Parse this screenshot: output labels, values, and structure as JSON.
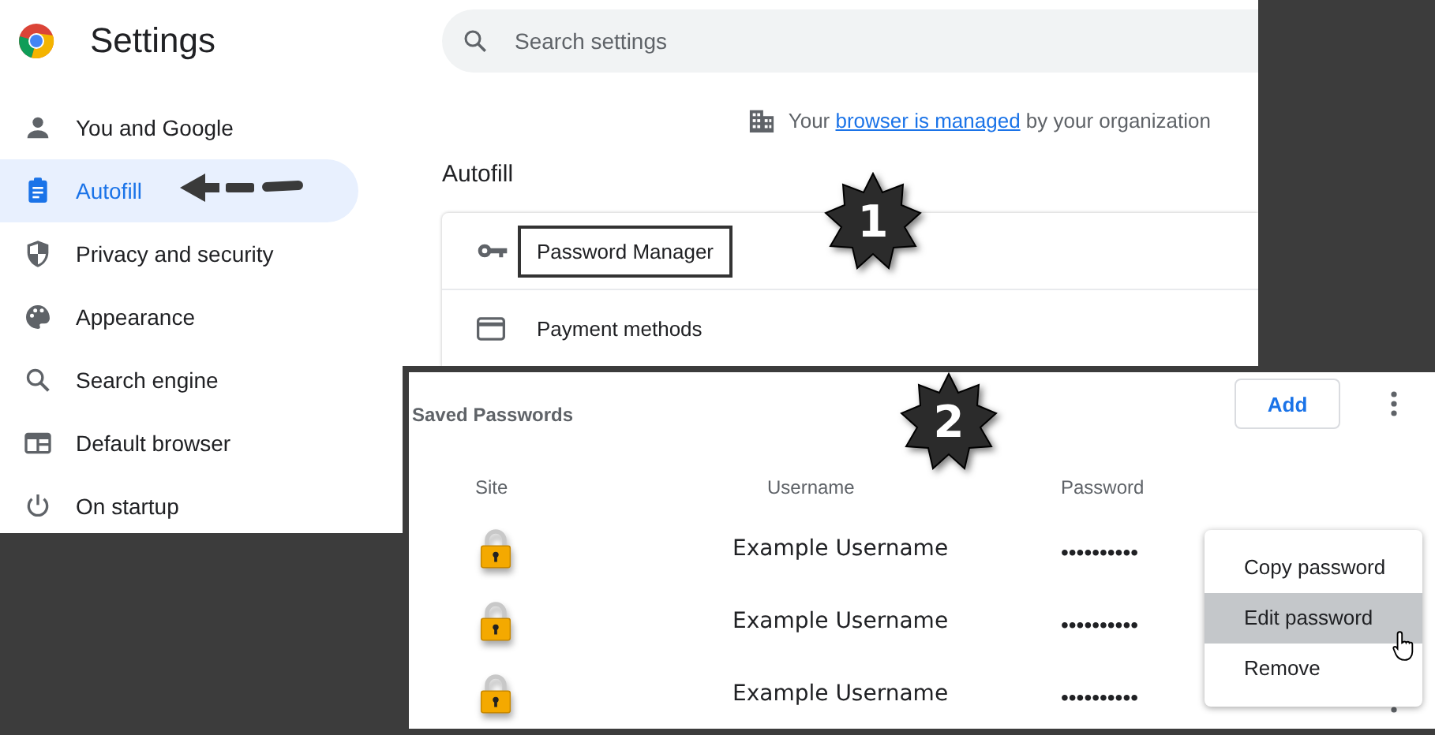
{
  "header": {
    "title": "Settings"
  },
  "search": {
    "placeholder": "Search settings"
  },
  "sidebar": {
    "items": [
      {
        "label": "You and Google",
        "selected": false
      },
      {
        "label": "Autofill",
        "selected": true
      },
      {
        "label": "Privacy and security",
        "selected": false
      },
      {
        "label": "Appearance",
        "selected": false
      },
      {
        "label": "Search engine",
        "selected": false
      },
      {
        "label": "Default browser",
        "selected": false
      },
      {
        "label": "On startup",
        "selected": false
      }
    ]
  },
  "managed_notice": {
    "before": "Your",
    "link": "browser is managed",
    "after": "by your organization"
  },
  "section_title": "Autofill",
  "autofill_items": [
    {
      "label": "Password Manager",
      "highlighted": true
    },
    {
      "label": "Payment methods",
      "highlighted": false
    }
  ],
  "callouts": [
    "1",
    "2"
  ],
  "saved_passwords": {
    "title": "Saved Passwords",
    "add_button": "Add",
    "columns": [
      "Site",
      "Username",
      "Password"
    ],
    "rows": [
      {
        "username": "Example Username",
        "password": "••••••••••"
      },
      {
        "username": "Example Username",
        "password": "••••••••••"
      },
      {
        "username": "Example Username",
        "password": "••••••••••"
      }
    ]
  },
  "context_menu": {
    "items": [
      {
        "label": "Copy password",
        "selected": false
      },
      {
        "label": "Edit password",
        "selected": true
      },
      {
        "label": "Remove",
        "selected": false
      }
    ]
  }
}
